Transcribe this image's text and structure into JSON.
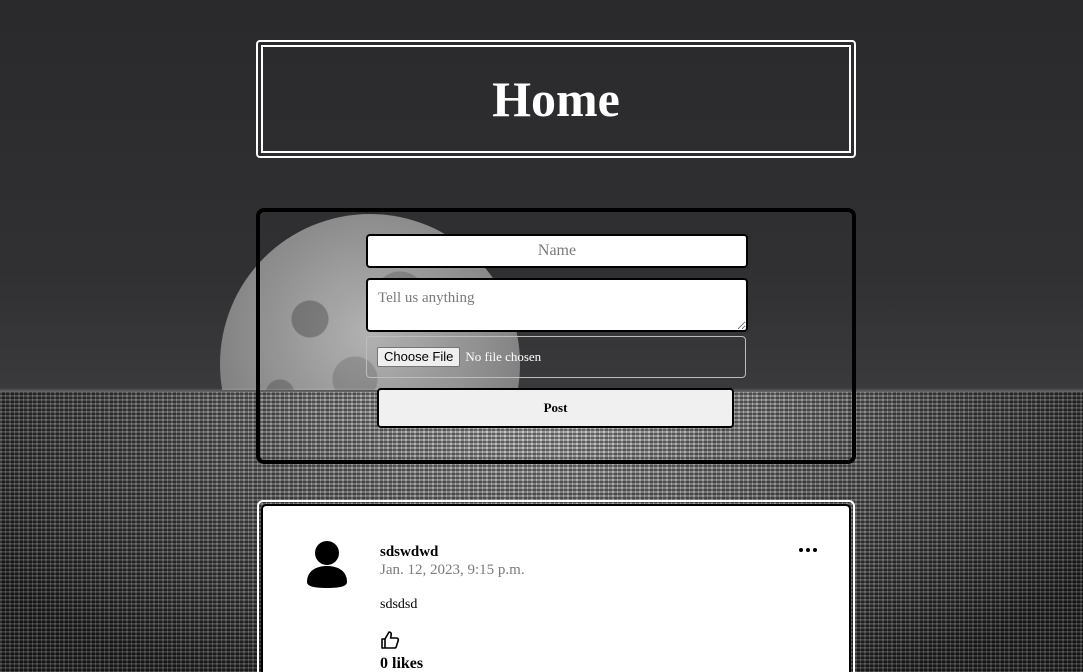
{
  "header": {
    "title": "Home"
  },
  "form": {
    "name_placeholder": "Name",
    "message_placeholder": "Tell us anything",
    "file_button_label": "Choose File",
    "file_status": "No file chosen",
    "post_button_label": "Post"
  },
  "posts": [
    {
      "author": "sdswdwd",
      "timestamp": "Jan. 12, 2023, 9:15 p.m.",
      "body": "sdsdsd",
      "likes_label": "0 likes",
      "avatar_icon": "user-avatar-icon",
      "menu_icon": "more-options-icon",
      "like_icon": "thumbs-up-icon"
    }
  ],
  "colors": {
    "background": "#2b2b2d",
    "header_border": "#ffffff",
    "panel_border": "#000000",
    "card_background": "#ffffff",
    "muted_text": "#7a7a7a"
  }
}
